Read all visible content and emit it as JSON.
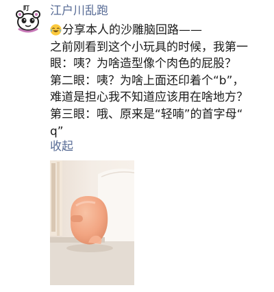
{
  "post": {
    "author": "江户川乱跑",
    "avatar": {
      "label": "盯",
      "icon": "cartoon-mascot-icon"
    },
    "emoji": "laughing-face-icon",
    "lines": [
      "分享本人的沙雕脑回路——",
      "之前刚看到这个小玩具的时候，我第一",
      "眼：咦？为啥造型像个肉色的屁股？",
      "第二眼：咦？为啥上面还印着个“b”，",
      "难道是担心我不知道应该用在啥地方？",
      "第三眼：哦、原来是“轻喃”的首字母“",
      "q”"
    ],
    "collapse_label": "收起",
    "photo": {
      "subject": "peach-colored-toy-on-shelf"
    },
    "colors": {
      "link": "#576b95",
      "text": "#1a1a1a",
      "toy": "#f3a888"
    }
  }
}
